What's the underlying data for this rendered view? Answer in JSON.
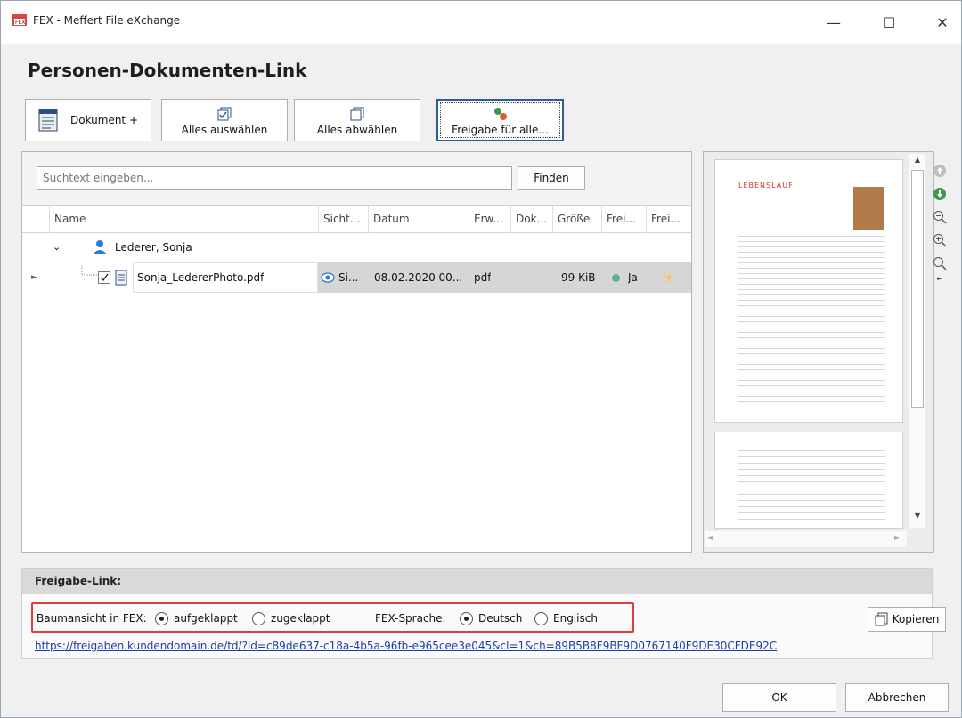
{
  "window": {
    "title": "FEX - Meffert File eXchange",
    "controls": {
      "minimize": "—",
      "maximize": "☐",
      "close": "✕"
    }
  },
  "page_title": "Personen-Dokumenten-Link",
  "toolbar": {
    "add_document": "Dokument +",
    "select_all": "Alles auswählen",
    "deselect_all": "Alles abwählen",
    "share_all": "Freigabe für alle..."
  },
  "search": {
    "placeholder": "Suchtext eingeben...",
    "find_label": "Finden"
  },
  "grid": {
    "columns": [
      "Name",
      "Sicht...",
      "Datum",
      "Erw...",
      "Dok...",
      "Größe",
      "Frei...",
      "Frei..."
    ],
    "group": {
      "name": "Lederer, Sonja"
    },
    "row": {
      "name": "Sonja_LedererPhoto.pdf",
      "visibility": "Si...",
      "date": "08.02.2020 00...",
      "extension": "pdf",
      "size": "99 KiB",
      "released": "Ja"
    }
  },
  "preview": {
    "page_heading": "LEBENSLAUF"
  },
  "link_panel": {
    "header": "Freigabe-Link:",
    "tree_view_label": "Baumansicht in FEX:",
    "tree_expanded": "aufgeklappt",
    "tree_collapsed": "zugeklappt",
    "language_label": "FEX-Sprache:",
    "lang_german": "Deutsch",
    "lang_english": "Englisch",
    "copy_label": "Kopieren",
    "url": "https://freigaben.kundendomain.de/td/?id=c89de637-c18a-4b5a-96fb-e965cee3e045&cl=1&ch=89B5B8F9BF9D0767140F9DE30CFDE92C"
  },
  "footer": {
    "ok": "OK",
    "cancel": "Abbrechen"
  },
  "colors": {
    "accent_green": "#3a9a4a",
    "status_dot": "#5dae8b",
    "highlight_red": "#e23b3b",
    "link_blue": "#1a3fa8"
  }
}
